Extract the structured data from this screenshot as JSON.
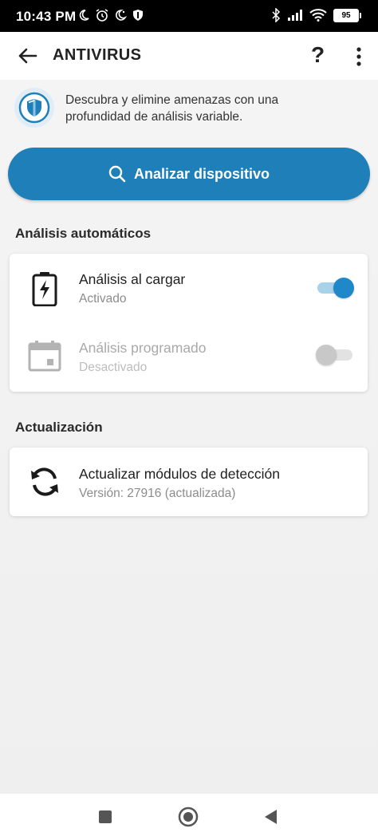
{
  "status_bar": {
    "time": "10:43 PM",
    "battery": "95",
    "icons": [
      "moon-icon",
      "alarm-icon",
      "moon-alt-icon",
      "shield-icon",
      "bluetooth-icon",
      "signal-icon",
      "wifi-icon",
      "battery-icon"
    ]
  },
  "app_bar": {
    "title": "ANTIVIRUS",
    "help": "?"
  },
  "intro": {
    "line1": "Descubra y elimine amenazas con una",
    "line2": "profundidad de análisis variable."
  },
  "scan_button": {
    "label": "Analizar dispositivo"
  },
  "sections": {
    "auto": {
      "title": "Análisis automáticos",
      "items": [
        {
          "label": "Análisis al cargar",
          "status": "Activado",
          "enabled": true
        },
        {
          "label": "Análisis programado",
          "status": "Desactivado",
          "enabled": false
        }
      ]
    },
    "update": {
      "title": "Actualización",
      "item": {
        "label": "Actualizar módulos de detección",
        "status": "Versión: 27916 (actualizada)"
      }
    }
  },
  "colors": {
    "accent": "#1f7fb8",
    "switch_on": "#1f88c9",
    "background": "#efefef"
  }
}
